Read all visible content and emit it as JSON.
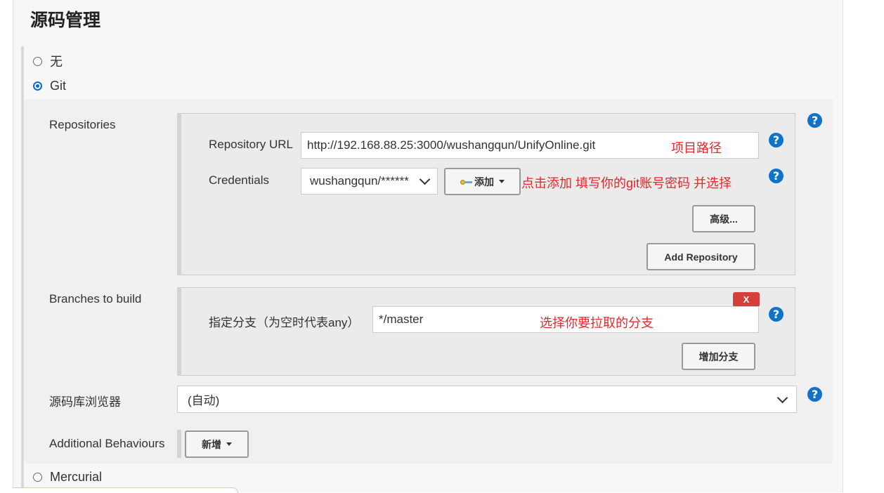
{
  "section": {
    "title": "源码管理"
  },
  "scm_options": {
    "none_label": "无",
    "git_label": "Git",
    "mercurial_label": "Mercurial",
    "selected": "Git"
  },
  "repositories": {
    "label": "Repositories",
    "url_label": "Repository URL",
    "url_value": "http://192.168.88.25:3000/wushangqun/UnifyOnline.git",
    "url_note": "项目路径",
    "credentials_label": "Credentials",
    "credentials_value": "wushangqun/******",
    "add_button": "添加",
    "credentials_note": "点击添加  填写你的git账号密码  并选择",
    "advanced_button": "高级...",
    "add_repository_button": "Add Repository"
  },
  "branches": {
    "label": "Branches to build",
    "delete_button": "X",
    "spec_label": "指定分支（为空时代表any）",
    "spec_value": "*/master",
    "spec_note": "选择你要拉取的分支",
    "add_branch_button": "增加分支"
  },
  "browser": {
    "label": "源码库浏览器",
    "value": "(自动)"
  },
  "behaviours": {
    "label": "Additional Behaviours",
    "add_button": "新增"
  },
  "help": {
    "glyph": "?"
  },
  "colors": {
    "help_blue": "#0f73c9",
    "note_red": "#e8262b",
    "delete_red": "#d43f3a",
    "radio_blue": "#0b6bd7"
  },
  "icons": {
    "help": "question-circle-icon",
    "credentials_add": "key-icon",
    "dropdown": "caret-down-icon",
    "select": "chevron-down-icon"
  }
}
